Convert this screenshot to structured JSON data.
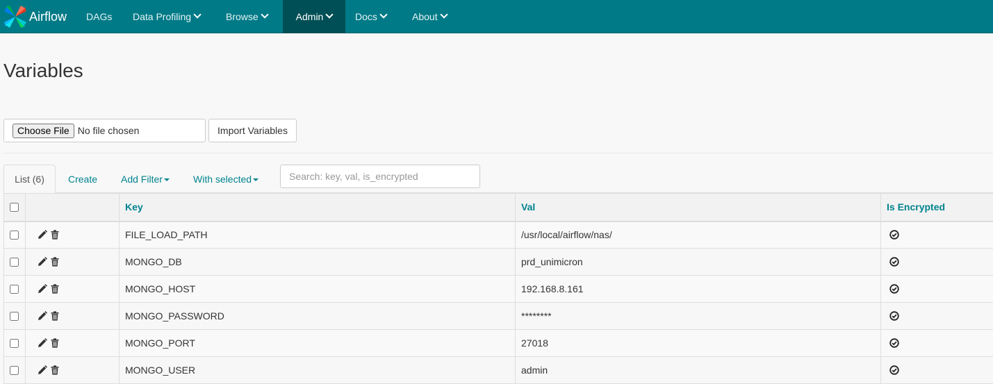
{
  "navbar": {
    "brand": "Airflow",
    "items": [
      {
        "label": "DAGs",
        "dropdown": false
      },
      {
        "label": "Data Profiling",
        "dropdown": true
      },
      {
        "label": "Browse",
        "dropdown": true
      },
      {
        "label": "Admin",
        "dropdown": true,
        "active": true
      },
      {
        "label": "Docs",
        "dropdown": true
      },
      {
        "label": "About",
        "dropdown": true
      }
    ],
    "bg_color": "#007a87",
    "active_color": "#004f56"
  },
  "page": {
    "title": "Variables"
  },
  "import": {
    "choose_file_label": "Choose File",
    "no_file_text": "No file chosen",
    "import_button": "Import Variables"
  },
  "tabs": {
    "list": "List (6)",
    "create": "Create",
    "add_filter": "Add Filter",
    "with_selected": "With selected"
  },
  "search": {
    "placeholder": "Search: key, val, is_encrypted",
    "value": ""
  },
  "table": {
    "columns": [
      "Key",
      "Val",
      "Is Encrypted"
    ],
    "rows": [
      {
        "key": "FILE_LOAD_PATH",
        "val": "/usr/local/airflow/nas/",
        "is_encrypted": true
      },
      {
        "key": "MONGO_DB",
        "val": "prd_unimicron",
        "is_encrypted": true
      },
      {
        "key": "MONGO_HOST",
        "val": "192.168.8.161",
        "is_encrypted": true
      },
      {
        "key": "MONGO_PASSWORD",
        "val": "********",
        "is_encrypted": true
      },
      {
        "key": "MONGO_PORT",
        "val": "27018",
        "is_encrypted": true
      },
      {
        "key": "MONGO_USER",
        "val": "admin",
        "is_encrypted": true
      }
    ],
    "icons": {
      "edit": "pencil-icon",
      "delete": "trash-icon",
      "encrypted": "check-circle-icon"
    }
  }
}
